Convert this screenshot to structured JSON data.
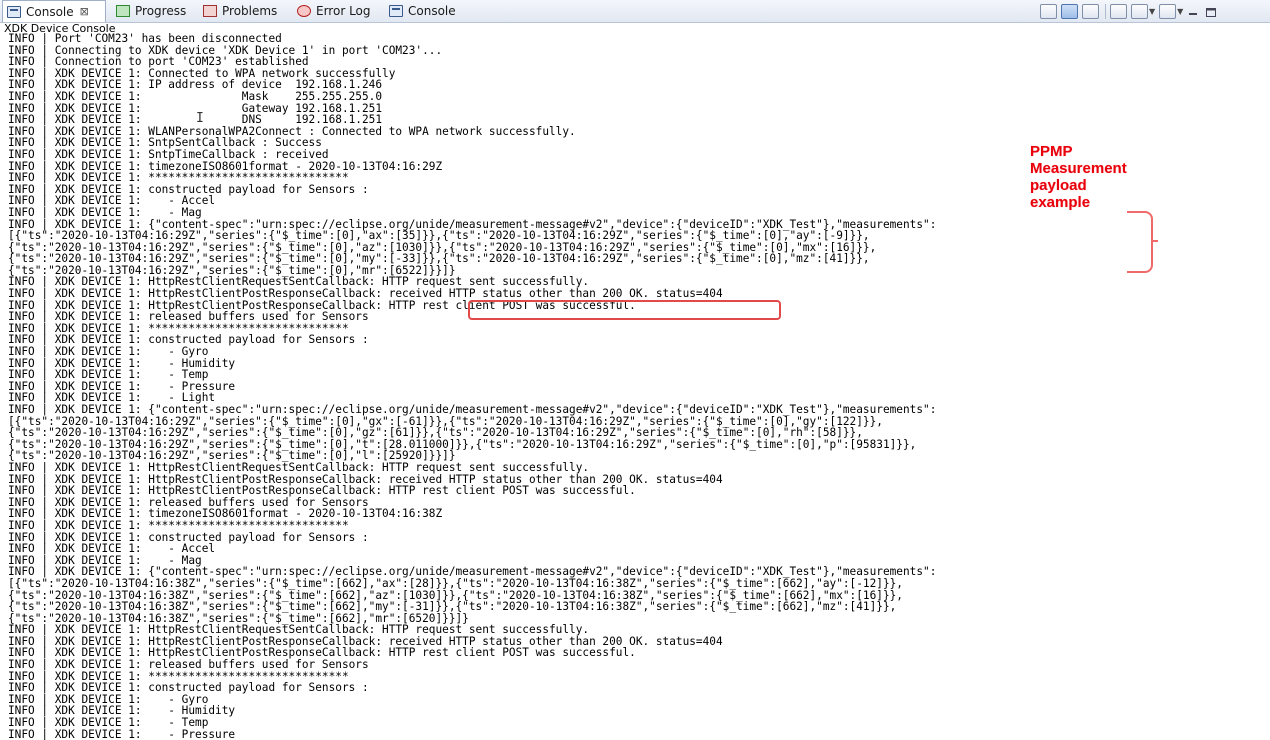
{
  "tabs": [
    {
      "label": "Console",
      "icon": "console-icon",
      "active": true
    },
    {
      "label": "Progress",
      "icon": "progress-icon"
    },
    {
      "label": "Problems",
      "icon": "problems-icon"
    },
    {
      "label": "Error Log",
      "icon": "error-log-icon"
    },
    {
      "label": "Console",
      "icon": "console-icon"
    }
  ],
  "tab_close": "⊠",
  "console_title": "XDK Device Console",
  "lines": [
    "INFO | Port 'COM23' has been disconnected",
    "INFO | Connecting to XDK device 'XDK Device 1' in port 'COM23'...",
    "INFO | Connection to port 'COM23' established",
    "INFO | XDK DEVICE 1: Connected to WPA network successfully",
    "INFO | XDK DEVICE 1: IP address of device  192.168.1.246",
    "INFO | XDK DEVICE 1:               Mask    255.255.255.0",
    "INFO | XDK DEVICE 1:               Gateway 192.168.1.251",
    "INFO | XDK DEVICE 1:               DNS     192.168.1.251",
    "INFO | XDK DEVICE 1: WLANPersonalWPA2Connect : Connected to WPA network successfully.",
    "INFO | XDK DEVICE 1: SntpSentCallback : Success",
    "INFO | XDK DEVICE 1: SntpTimeCallback : received",
    "INFO | XDK DEVICE 1: timezoneISO8601format - 2020-10-13T04:16:29Z",
    "INFO | XDK DEVICE 1: ******************************",
    "INFO | XDK DEVICE 1: constructed payload for Sensors :",
    "INFO | XDK DEVICE 1:    - Accel",
    "INFO | XDK DEVICE 1:    - Mag",
    "INFO | XDK DEVICE 1: {\"content-spec\":\"urn:spec://eclipse.org/unide/measurement-message#v2\",\"device\":{\"deviceID\":\"XDK_Test\"},\"measurements\":",
    "[{\"ts\":\"2020-10-13T04:16:29Z\",\"series\":{\"$_time\":[0],\"ax\":[35]}},{\"ts\":\"2020-10-13T04:16:29Z\",\"series\":{\"$_time\":[0],\"ay\":[-9]}},",
    "{\"ts\":\"2020-10-13T04:16:29Z\",\"series\":{\"$_time\":[0],\"az\":[1030]}},{\"ts\":\"2020-10-13T04:16:29Z\",\"series\":{\"$_time\":[0],\"mx\":[16]}},",
    "{\"ts\":\"2020-10-13T04:16:29Z\",\"series\":{\"$_time\":[0],\"my\":[-33]}},{\"ts\":\"2020-10-13T04:16:29Z\",\"series\":{\"$_time\":[0],\"mz\":[41]}},",
    "{\"ts\":\"2020-10-13T04:16:29Z\",\"series\":{\"$_time\":[0],\"mr\":[6522]}}]}",
    "INFO | XDK DEVICE 1: HttpRestClientRequestSentCallback: HTTP request sent successfully.",
    "INFO | XDK DEVICE 1: HttpRestClientPostResponseCallback: received HTTP status other than 200 OK. status=404",
    "INFO | XDK DEVICE 1: HttpRestClientPostResponseCallback: HTTP rest client POST was successful.",
    "INFO | XDK DEVICE 1: released buffers used for Sensors",
    "INFO | XDK DEVICE 1: ******************************",
    "INFO | XDK DEVICE 1: constructed payload for Sensors :",
    "INFO | XDK DEVICE 1:    - Gyro",
    "INFO | XDK DEVICE 1:    - Humidity",
    "INFO | XDK DEVICE 1:    - Temp",
    "INFO | XDK DEVICE 1:    - Pressure",
    "INFO | XDK DEVICE 1:    - Light",
    "INFO | XDK DEVICE 1: {\"content-spec\":\"urn:spec://eclipse.org/unide/measurement-message#v2\",\"device\":{\"deviceID\":\"XDK_Test\"},\"measurements\":",
    "[{\"ts\":\"2020-10-13T04:16:29Z\",\"series\":{\"$_time\":[0],\"gx\":[-61]}},{\"ts\":\"2020-10-13T04:16:29Z\",\"series\":{\"$_time\":[0],\"gy\":[122]}},",
    "{\"ts\":\"2020-10-13T04:16:29Z\",\"series\":{\"$_time\":[0],\"gz\":[61]}},{\"ts\":\"2020-10-13T04:16:29Z\",\"series\":{\"$_time\":[0],\"rh\":[58]}},",
    "{\"ts\":\"2020-10-13T04:16:29Z\",\"series\":{\"$_time\":[0],\"t\":[28.011000]}},{\"ts\":\"2020-10-13T04:16:29Z\",\"series\":{\"$_time\":[0],\"p\":[95831]}},",
    "{\"ts\":\"2020-10-13T04:16:29Z\",\"series\":{\"$_time\":[0],\"l\":[25920]}}]}",
    "INFO | XDK DEVICE 1: HttpRestClientRequestSentCallback: HTTP request sent successfully.",
    "INFO | XDK DEVICE 1: HttpRestClientPostResponseCallback: received HTTP status other than 200 OK. status=404",
    "INFO | XDK DEVICE 1: HttpRestClientPostResponseCallback: HTTP rest client POST was successful.",
    "INFO | XDK DEVICE 1: released buffers used for Sensors",
    "INFO | XDK DEVICE 1: timezoneISO8601format - 2020-10-13T04:16:38Z",
    "INFO | XDK DEVICE 1: ******************************",
    "INFO | XDK DEVICE 1: constructed payload for Sensors :",
    "INFO | XDK DEVICE 1:    - Accel",
    "INFO | XDK DEVICE 1:    - Mag",
    "INFO | XDK DEVICE 1: {\"content-spec\":\"urn:spec://eclipse.org/unide/measurement-message#v2\",\"device\":{\"deviceID\":\"XDK_Test\"},\"measurements\":",
    "[{\"ts\":\"2020-10-13T04:16:38Z\",\"series\":{\"$_time\":[662],\"ax\":[28]}},{\"ts\":\"2020-10-13T04:16:38Z\",\"series\":{\"$_time\":[662],\"ay\":[-12]}},",
    "{\"ts\":\"2020-10-13T04:16:38Z\",\"series\":{\"$_time\":[662],\"az\":[1030]}},{\"ts\":\"2020-10-13T04:16:38Z\",\"series\":{\"$_time\":[662],\"mx\":[16]}},",
    "{\"ts\":\"2020-10-13T04:16:38Z\",\"series\":{\"$_time\":[662],\"my\":[-31]}},{\"ts\":\"2020-10-13T04:16:38Z\",\"series\":{\"$_time\":[662],\"mz\":[41]}},",
    "{\"ts\":\"2020-10-13T04:16:38Z\",\"series\":{\"$_time\":[662],\"mr\":[6520]}}]}",
    "INFO | XDK DEVICE 1: HttpRestClientRequestSentCallback: HTTP request sent successfully.",
    "INFO | XDK DEVICE 1: HttpRestClientPostResponseCallback: received HTTP status other than 200 OK. status=404",
    "INFO | XDK DEVICE 1: HttpRestClientPostResponseCallback: HTTP rest client POST was successful.",
    "INFO | XDK DEVICE 1: released buffers used for Sensors",
    "INFO | XDK DEVICE 1: ******************************",
    "INFO | XDK DEVICE 1: constructed payload for Sensors :",
    "INFO | XDK DEVICE 1:    - Gyro",
    "INFO | XDK DEVICE 1:    - Humidity",
    "INFO | XDK DEVICE 1:    - Temp",
    "INFO | XDK DEVICE 1:    - Pressure"
  ],
  "annotation_label": "PPMP\nMeasurement\npayload\nexample",
  "annotation_color": "#e8000b",
  "toolbar_icons": [
    "clear-console-icon",
    "scroll-lock-icon",
    "word-wrap-icon",
    "pin-console-icon",
    "display-selected-console-icon",
    "open-console-icon",
    "minimize-icon",
    "maximize-icon"
  ]
}
